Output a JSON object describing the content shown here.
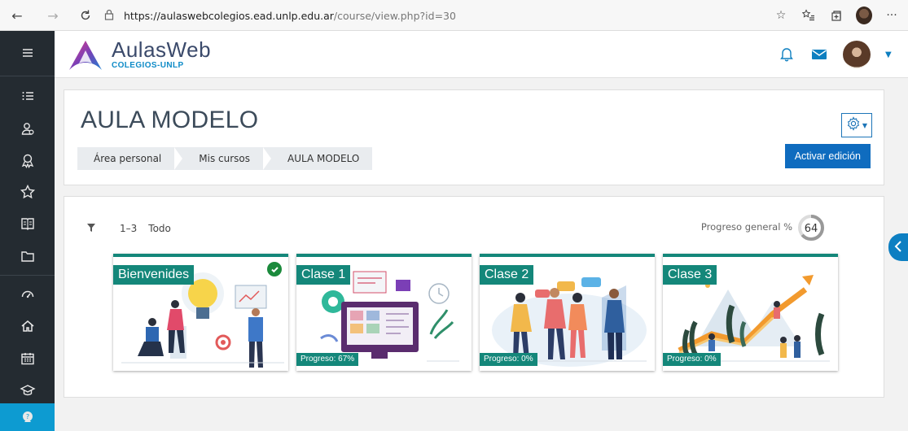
{
  "browser": {
    "url_host": "https://aulaswebcolegios.ead.unlp.edu.ar",
    "url_path": "/course/view.php?id=30",
    "icons": [
      "back-icon",
      "forward-icon",
      "refresh-icon",
      "lock-icon",
      "favorite-icon",
      "favorites-bar-icon",
      "collections-icon",
      "profile-icon",
      "more-icon"
    ]
  },
  "header": {
    "logo_title": "AulasWeb",
    "logo_subtitle": "COLEGIOS-UNLP",
    "icons": [
      "bell-icon",
      "mail-icon",
      "avatar",
      "chevron-down-icon"
    ]
  },
  "leftnav": {
    "items": [
      "menu-icon",
      "list-icon",
      "participants-icon",
      "badges-icon",
      "star-icon",
      "gradebook-icon",
      "folder-icon",
      "dashboard-icon",
      "home-icon",
      "calendar-icon",
      "graduation-cap-icon",
      "help-icon"
    ]
  },
  "course": {
    "title": "AULA MODELO",
    "breadcrumb": [
      "Área personal",
      "Mis cursos",
      "AULA MODELO"
    ],
    "edit_button": "Activar edición"
  },
  "content": {
    "range": "1–3",
    "all": "Todo",
    "progress_label": "Progreso general %",
    "progress_value": "64",
    "tiles": [
      {
        "title": "Bienvenides",
        "progress": "",
        "completed": true
      },
      {
        "title": "Clase 1",
        "progress": "Progreso: 67%"
      },
      {
        "title": "Clase 2",
        "progress": "Progreso: 0%"
      },
      {
        "title": "Clase 3",
        "progress": "Progreso: 0%"
      }
    ]
  },
  "colors": {
    "accent": "#0f6cbf",
    "tile_teal": "#14877a",
    "nav_bg": "#242b31",
    "nav_active": "#0d9bd1"
  }
}
